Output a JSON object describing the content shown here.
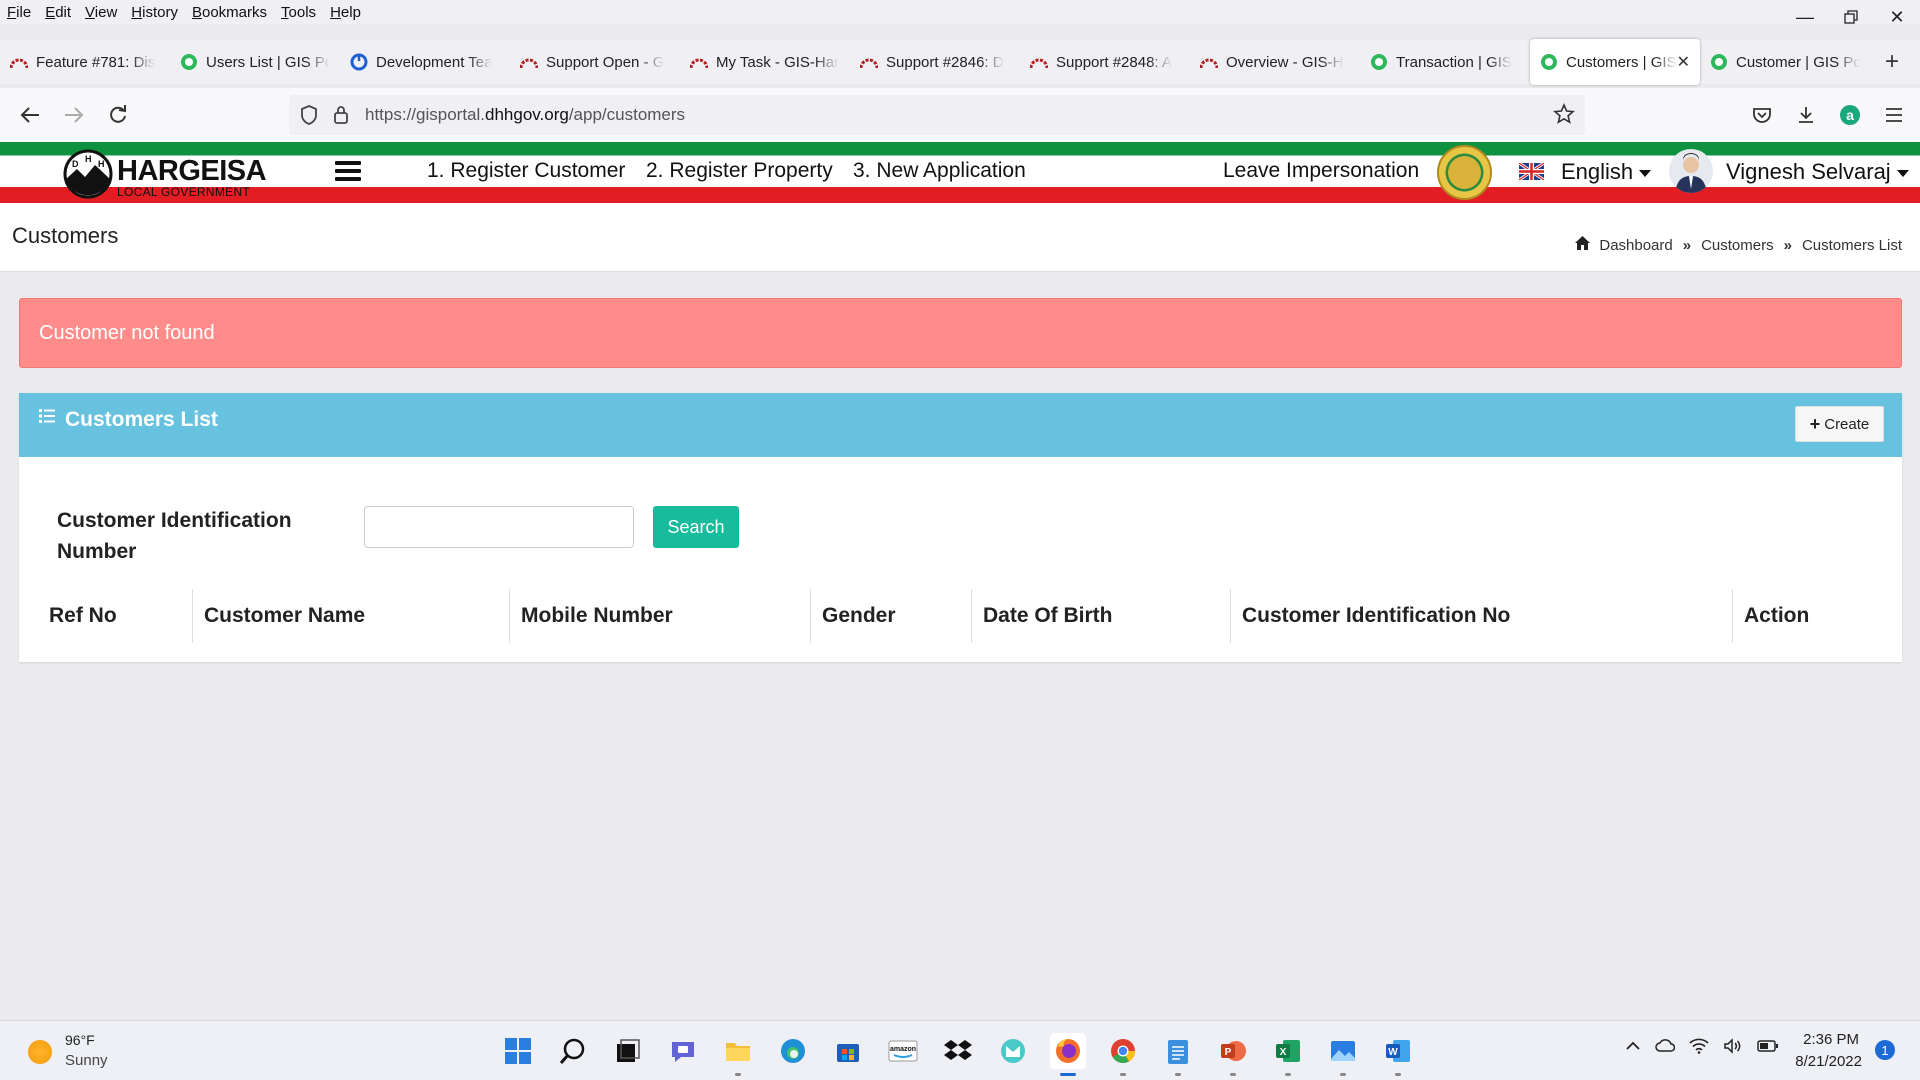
{
  "browser": {
    "menu": [
      "File",
      "Edit",
      "View",
      "History",
      "Bookmarks",
      "Tools",
      "Help"
    ],
    "tabs": [
      {
        "label": "Feature #781: Dis",
        "favicon": "redmine-icon"
      },
      {
        "label": "Users List | GIS Po",
        "favicon": "gis-portal-icon"
      },
      {
        "label": "Development Tea",
        "favicon": "blue-circle-icon"
      },
      {
        "label": "Support Open - G",
        "favicon": "redmine-icon"
      },
      {
        "label": "My Task - GIS-Har",
        "favicon": "redmine-icon"
      },
      {
        "label": "Support #2846: D",
        "favicon": "redmine-icon"
      },
      {
        "label": "Support #2848: A",
        "favicon": "redmine-icon"
      },
      {
        "label": "Overview - GIS-H",
        "favicon": "redmine-icon"
      },
      {
        "label": "Transaction | GIS",
        "favicon": "gis-portal-icon"
      },
      {
        "label": "Customers | GIS",
        "favicon": "gis-portal-icon",
        "active": true
      },
      {
        "label": "Customer | GIS Po",
        "favicon": "gis-portal-icon"
      }
    ],
    "url_prefix": "https://gisportal.",
    "url_domain": "dhhgov.org",
    "url_path": "/app/customers"
  },
  "header": {
    "logo_text": "HARGEISA",
    "logo_sub": "LOCAL GOVERNMENT",
    "nav": [
      "1. Register Customer",
      "2. Register Property",
      "3. New Application"
    ],
    "leave_impersonation": "Leave Impersonation",
    "language": "English",
    "user_name": "Vignesh Selvaraj"
  },
  "page": {
    "title": "Customers",
    "breadcrumb": [
      "Dashboard",
      "Customers",
      "Customers List"
    ],
    "alert": "Customer not found",
    "box_title": "Customers List",
    "create_label": "Create",
    "search_label": "Customer Identification Number",
    "search_value": "",
    "search_button": "Search",
    "columns": [
      "Ref No",
      "Customer Name",
      "Mobile Number",
      "Gender",
      "Date Of Birth",
      "Customer Identification No",
      "Action"
    ],
    "rows": []
  },
  "taskbar": {
    "temperature": "96°F",
    "condition": "Sunny",
    "time": "2:36 PM",
    "date": "8/21/2022",
    "notifications": "1"
  },
  "colors": {
    "header_green": "#0f9240",
    "header_red": "#e31d24",
    "alert_bg": "#ff8c8a",
    "box_header": "#67c2e0",
    "search_btn": "#18bc9c"
  }
}
